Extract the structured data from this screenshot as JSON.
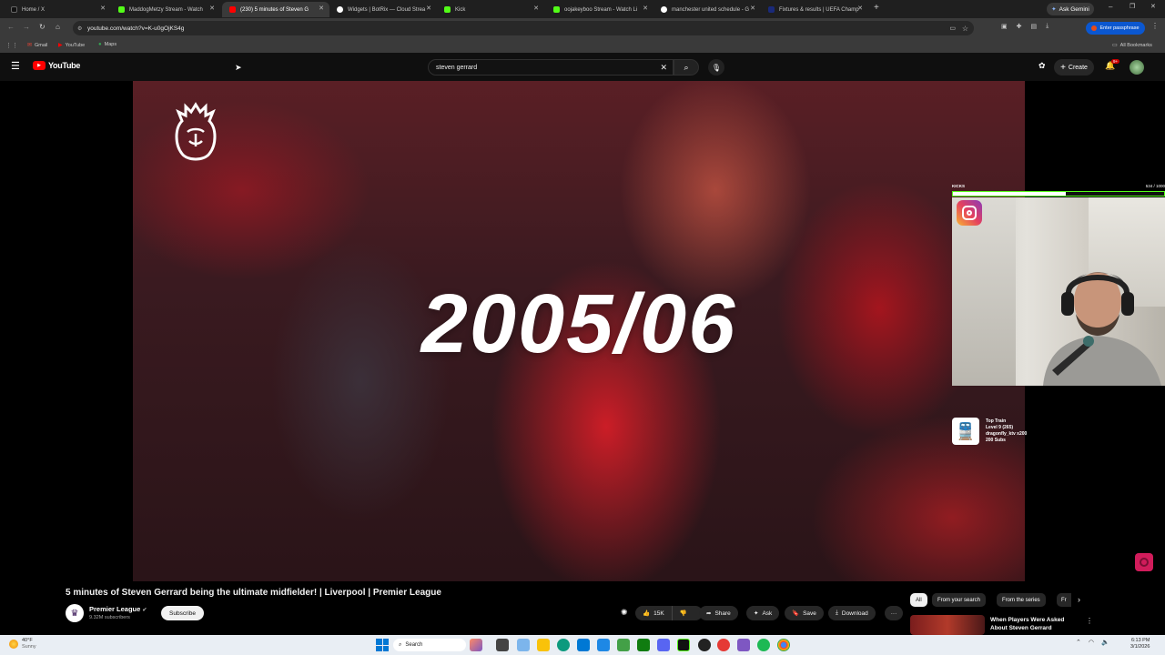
{
  "browser": {
    "tabs": [
      {
        "label": "Home / X",
        "color": "#111111"
      },
      {
        "label": "MaddogMetzy Stream - Watch",
        "color": "#53fc18"
      },
      {
        "label": "(230) 5 minutes of Steven G",
        "color": "#ff0000"
      },
      {
        "label": "Widgets | BotRix — Cloud Strea",
        "color": "#ffffff"
      },
      {
        "label": "Kick",
        "color": "#53fc18"
      },
      {
        "label": "oojakeyboo Stream - Watch Li",
        "color": "#53fc18"
      },
      {
        "label": "manchester united schedule - G",
        "color": "#ffffff"
      },
      {
        "label": "Fixtures & results | UEFA Champ",
        "color": "#1a2a7a"
      }
    ],
    "ask_gemini": "Ask Gemini",
    "url": "youtube.com/watch?v=K-u0gOjKS4g",
    "passphrase_label": "Enter passphrase",
    "bookmarks": [
      "Gmail",
      "YouTube",
      "Maps"
    ],
    "all_bookmarks": "All Bookmarks"
  },
  "youtube": {
    "logo_text": "YouTube",
    "search_value": "steven gerrard",
    "create_label": "Create",
    "notif_badge": "9+"
  },
  "video": {
    "year_text": "2005/06",
    "title": "5 minutes of Steven Gerrard being the ultimate midfielder! | Liverpool | Premier League"
  },
  "overlay": {
    "kicks_label": "KICKS",
    "kicks_count": "534 / 1000",
    "kicks_progress": 0.534,
    "top_train_title": "Top Train",
    "top_train_level": "Level 9  (265)",
    "top_train_user": "dragonfly_ktv x200",
    "top_train_subs": "200 Subs"
  },
  "channel": {
    "name": "Premier League",
    "subscribers": "9.32M subscribers",
    "subscribe_label": "Subscribe"
  },
  "actions": {
    "likes": "15K",
    "share": "Share",
    "ask": "Ask",
    "save": "Save",
    "download": "Download"
  },
  "chips": [
    "All",
    "From your search",
    "From the series",
    "Fr"
  ],
  "related": {
    "title_line1": "When Players Were Asked",
    "title_line2": "About Steven Gerrard"
  },
  "taskbar": {
    "weather_temp": "40°F",
    "weather_desc": "Sunny",
    "search_label": "Search",
    "time": "6:13 PM",
    "date": "3/1/2026"
  }
}
